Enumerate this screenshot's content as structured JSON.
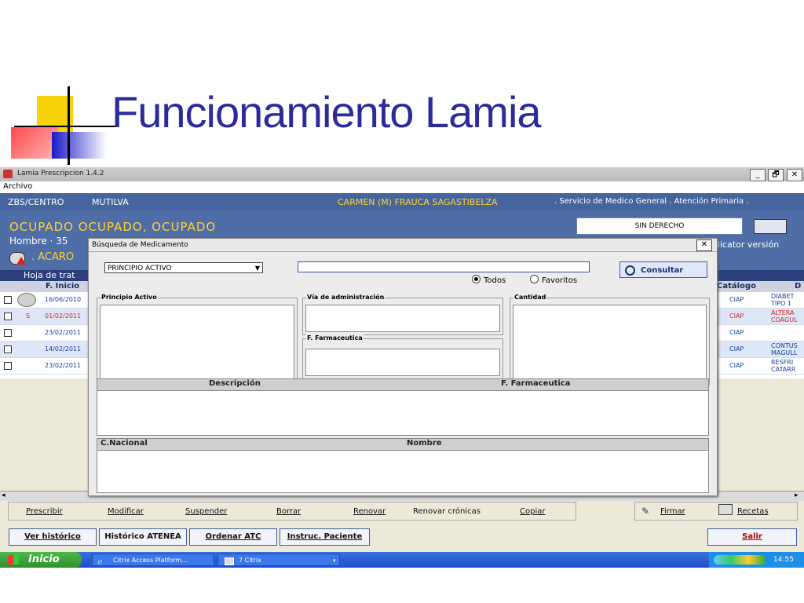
{
  "slide": {
    "title": "Funcionamiento Lamia"
  },
  "window": {
    "title": "Lamia Prescripcion 1.4.2",
    "min": "_",
    "max": "🗗",
    "close": "✕"
  },
  "menu": {
    "archivo": "Archivo"
  },
  "header": {
    "zbs_label": "ZBS/CENTRO",
    "zbs_value": "MUTILVA",
    "doctor": "CARMEN (M) FRAUCA SAGASTIBELZA",
    "service": ". Servicio de Medico General . Atención Primaria .",
    "patient": "OCUPADO OCUPADO, OCUPADO",
    "patient_sub": "Hombre · 35",
    "derecho": "SIN DERECHO",
    "indicator": "dicator versión",
    "acar": ". ACARO"
  },
  "grid": {
    "section": "Hoja de trat",
    "col_inicio": "F. Inicio",
    "col_catalogo": "Catálogo",
    "col_d": "D",
    "rows": [
      {
        "date": "16/06/2010",
        "cat": "CIAP",
        "desc1": "DIABET",
        "desc2": "TIPO 1"
      },
      {
        "mark": "S",
        "date": "01/02/2011",
        "cat": "CIAP",
        "desc1": "ALTERA",
        "desc2": "COAGUL"
      },
      {
        "date": "23/02/2011",
        "cat": "CIAP",
        "desc1": "",
        "desc2": ""
      },
      {
        "date": "14/02/2011",
        "cat": "CIAP",
        "desc1": "CONTUS",
        "desc2": "MAGULL"
      },
      {
        "date": "23/02/2011",
        "cat": "CIAP",
        "desc1": "RESFRI",
        "desc2": "CATARR"
      }
    ]
  },
  "dialog": {
    "title": "Búsqueda de Medicamento",
    "close": "✕",
    "search_type": "PRINCIPIO ACTIVO",
    "consultar": "Consultar",
    "radio_todos": "Todos",
    "radio_favoritos": "Favoritos",
    "group_principio": "Principio Activo",
    "group_via": "Vía de administración",
    "group_cantidad": "Cantidad",
    "group_farm": "F. Farmaceutica",
    "table1_col1": "Descripción",
    "table1_col2": "F. Farmaceutica",
    "table2_col1": "C.Nacional",
    "table2_col2": "Nombre"
  },
  "actions": {
    "prescribir": "Prescribir",
    "modificar": "Modificar",
    "suspender": "Suspender",
    "borrar": "Borrar",
    "renovar": "Renovar",
    "renovar_cronicas": "Renovar crónicas",
    "copiar": "Copiar",
    "firmar": "Firmar",
    "recetas": "Recetas",
    "ver_historico": "Ver histórico",
    "historico_atenea": "Histórico ATENEA",
    "ordenar_atc": "Ordenar ATC",
    "instruc_paciente": "Instruc. Paciente",
    "salir": "Salir"
  },
  "taskbar": {
    "start": "Inicio",
    "task1": "Citrix Access Platform...",
    "task2": "7 Citrix",
    "clock": "14:55"
  }
}
